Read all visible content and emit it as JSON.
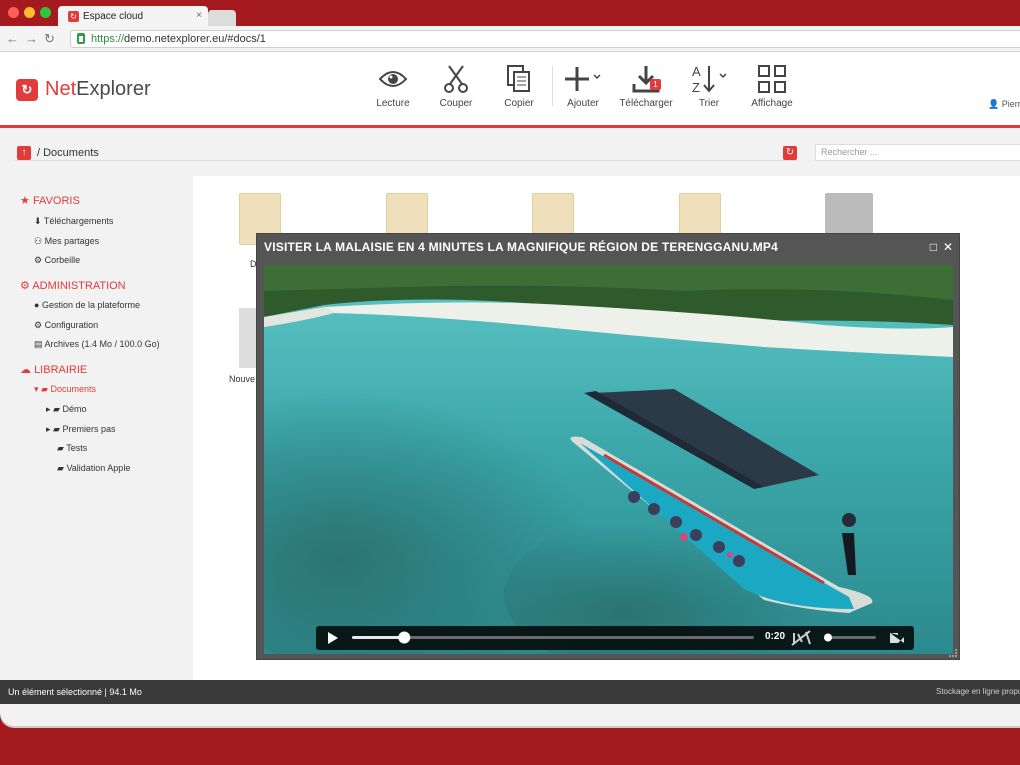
{
  "browser": {
    "tab_title": "Espace cloud",
    "tab_close": "×",
    "url_scheme": "https://",
    "url_rest": "demo.netexplorer.eu/#docs/1",
    "dot_colors": [
      "#ff5f57",
      "#febc2e",
      "#28c840"
    ]
  },
  "app": {
    "logo_mark": "↻",
    "logo_net": "Net",
    "logo_explorer": "Explorer",
    "user_name": "Pierr",
    "accent": "#e23b3b"
  },
  "toolbar": [
    {
      "label": "Lecture",
      "icon": "eye-icon"
    },
    {
      "label": "Couper",
      "icon": "scissors-icon"
    },
    {
      "label": "Copier",
      "icon": "copy-icon"
    },
    {
      "label": "Ajouter",
      "icon": "plus-icon"
    },
    {
      "label": "Télécharger",
      "icon": "download-icon",
      "badge": "1"
    },
    {
      "label": "Trier",
      "icon": "sort-az-icon"
    },
    {
      "label": "Affichage",
      "icon": "grid-icon"
    }
  ],
  "breadcrumb": {
    "text": "/ Documents",
    "up": "↑",
    "refresh": "↻"
  },
  "search": {
    "placeholder": "Rechercher ..."
  },
  "sidebar": {
    "favoris": {
      "title": "FAVORIS",
      "items": [
        "Téléchargements",
        "Mes partages",
        "Corbeille"
      ]
    },
    "administration": {
      "title": "ADMINISTRATION",
      "items": [
        "Gestion de la plateforme",
        "Configuration",
        "Archives  (1.4 Mo / 100.0 Go)"
      ]
    },
    "librairie": {
      "title": "LIBRAIRIE",
      "items": [
        "Documents",
        "Démo",
        "Premiers pas",
        "Tests",
        "Validation Apple"
      ]
    }
  },
  "files": {
    "label_1": "D",
    "label_2": "Nouve"
  },
  "status": {
    "left": "Un élément sélectionné | 94.1 Mo",
    "right": "Stockage en ligne propul"
  },
  "player": {
    "title": "VISITER LA MALAISIE EN 4 MINUTES LA MAGNIFIQUE RÉGION DE TERENGGANU.MP4",
    "time": "0:20",
    "progress": 0.13,
    "volume": 0.0
  }
}
